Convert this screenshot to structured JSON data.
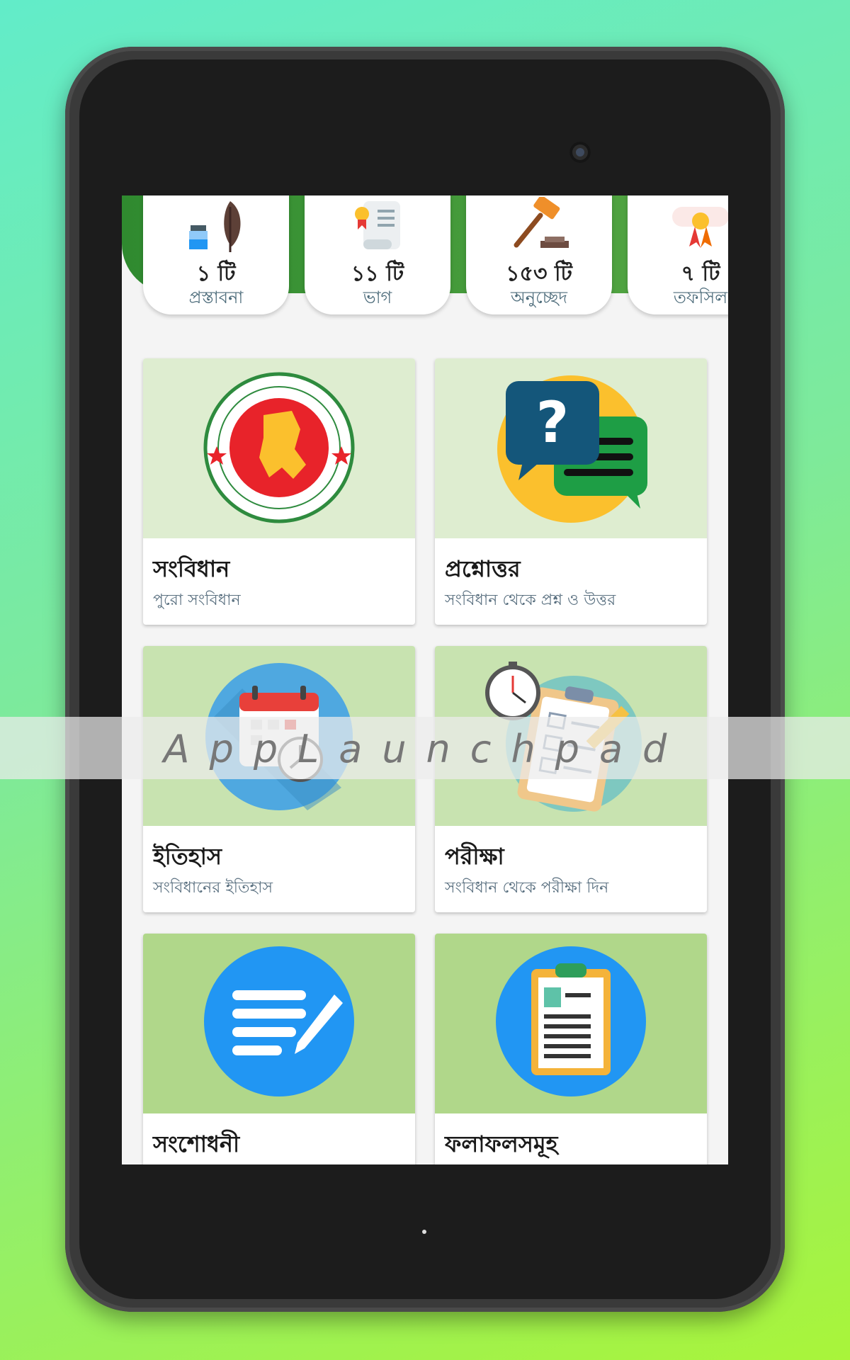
{
  "stats": [
    {
      "count": "১ টি",
      "label": "প্রস্তাবনা",
      "icon": "ink-quill-icon"
    },
    {
      "count": "১১ টি",
      "label": "ভাগ",
      "icon": "scroll-certificate-icon"
    },
    {
      "count": "১৫৩ টি",
      "label": "অনুচ্ছেদ",
      "icon": "gavel-icon"
    },
    {
      "count": "৭ টি",
      "label": "তফসিল",
      "icon": "diploma-ribbon-icon"
    }
  ],
  "cards": [
    {
      "title": "সংবিধান",
      "subtitle": "পুরো সংবিধান",
      "icon": "government-seal-icon",
      "bg": "#deedd0"
    },
    {
      "title": "প্রশ্নোত্তর",
      "subtitle": "সংবিধান থেকে প্রশ্ন ও উত্তর",
      "icon": "question-chat-icon",
      "bg": "#deedd0"
    },
    {
      "title": "ইতিহাস",
      "subtitle": "সংবিধানের ইতিহাস",
      "icon": "calendar-clock-icon",
      "bg": "#c8e3b0"
    },
    {
      "title": "পরীক্ষা",
      "subtitle": "সংবিধান থেকে পরীক্ষা দিন",
      "icon": "exam-clipboard-stopwatch-icon",
      "bg": "#c8e3b0"
    },
    {
      "title": "সংশোধনী",
      "subtitle": "",
      "icon": "edit-document-icon",
      "bg": "#b0d78a"
    },
    {
      "title": "ফলাফলসমূহ",
      "subtitle": "",
      "icon": "results-clipboard-icon",
      "bg": "#b0d78a"
    }
  ],
  "watermark": "AppLaunchpad",
  "colors": {
    "green_band": "#2f8a2f",
    "circle_blue": "#2196f3",
    "seal_red": "#e8232a",
    "accent_yellow": "#fbc02d"
  }
}
